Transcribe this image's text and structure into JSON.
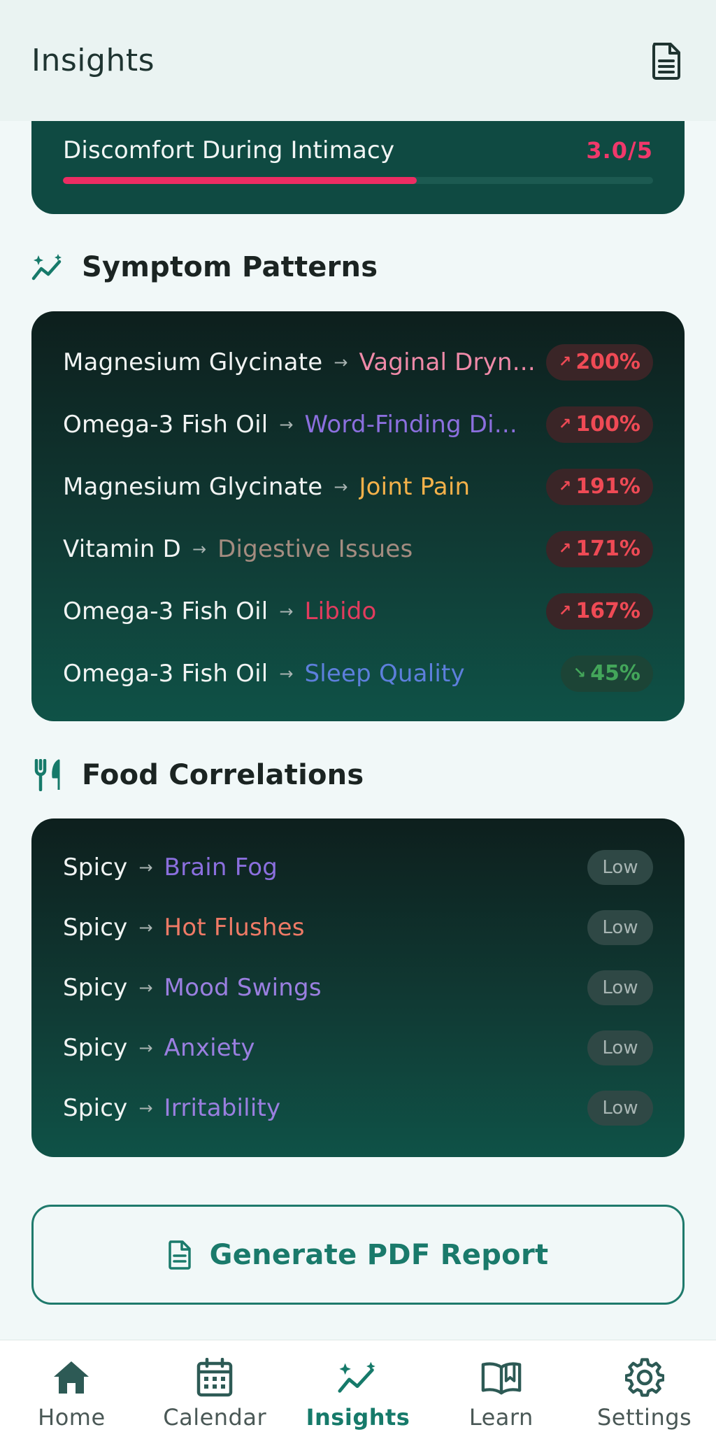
{
  "header": {
    "title": "Insights",
    "report_icon": "document-icon"
  },
  "metric": {
    "label": "Discomfort During Intimacy",
    "value": "3.0/5",
    "progress": 0.6,
    "color": "#ec2d63"
  },
  "symptom_patterns": {
    "title": "Symptom Patterns",
    "icon": "trend-sparkle-icon",
    "items": [
      {
        "cause": "Magnesium Glycinate",
        "effect": "Vaginal Dryn...",
        "effect_color": "#ef8aa8",
        "change": "200%",
        "direction": "up"
      },
      {
        "cause": "Omega-3 Fish Oil",
        "effect": "Word-Finding Di...",
        "effect_color": "#8b6fde",
        "change": "100%",
        "direction": "up"
      },
      {
        "cause": "Magnesium Glycinate",
        "effect": "Joint Pain",
        "effect_color": "#f4b14a",
        "change": "191%",
        "direction": "up"
      },
      {
        "cause": "Vitamin D",
        "effect": "Digestive Issues",
        "effect_color": "#a48c80",
        "change": "171%",
        "direction": "up"
      },
      {
        "cause": "Omega-3 Fish Oil",
        "effect": "Libido",
        "effect_color": "#e23c5e",
        "change": "167%",
        "direction": "up"
      },
      {
        "cause": "Omega-3 Fish Oil",
        "effect": "Sleep Quality",
        "effect_color": "#5d7fdc",
        "change": "45%",
        "direction": "down"
      }
    ]
  },
  "food_correlations": {
    "title": "Food Correlations",
    "icon": "utensils-icon",
    "items": [
      {
        "food": "Spicy",
        "effect": "Brain Fog",
        "effect_color": "#8b6fde",
        "strength": "Low"
      },
      {
        "food": "Spicy",
        "effect": "Hot Flushes",
        "effect_color": "#ef7a66",
        "strength": "Low"
      },
      {
        "food": "Spicy",
        "effect": "Mood Swings",
        "effect_color": "#9a7fe0",
        "strength": "Low"
      },
      {
        "food": "Spicy",
        "effect": "Anxiety",
        "effect_color": "#9a7fe0",
        "strength": "Low"
      },
      {
        "food": "Spicy",
        "effect": "Irritability",
        "effect_color": "#9a7fe0",
        "strength": "Low"
      }
    ]
  },
  "pdf_button": {
    "label": "Generate PDF Report",
    "icon": "document-icon"
  },
  "nav": {
    "items": [
      {
        "label": "Home",
        "icon": "home-icon"
      },
      {
        "label": "Calendar",
        "icon": "calendar-icon"
      },
      {
        "label": "Insights",
        "icon": "trend-sparkle-icon",
        "active": true
      },
      {
        "label": "Learn",
        "icon": "book-icon"
      },
      {
        "label": "Settings",
        "icon": "gear-icon"
      }
    ]
  },
  "colors": {
    "accent": "#167a6a",
    "header_bg": "#eaf3f2",
    "page_bg": "#f1f8f8",
    "up": "#ef4a55",
    "down": "#43a65a"
  }
}
